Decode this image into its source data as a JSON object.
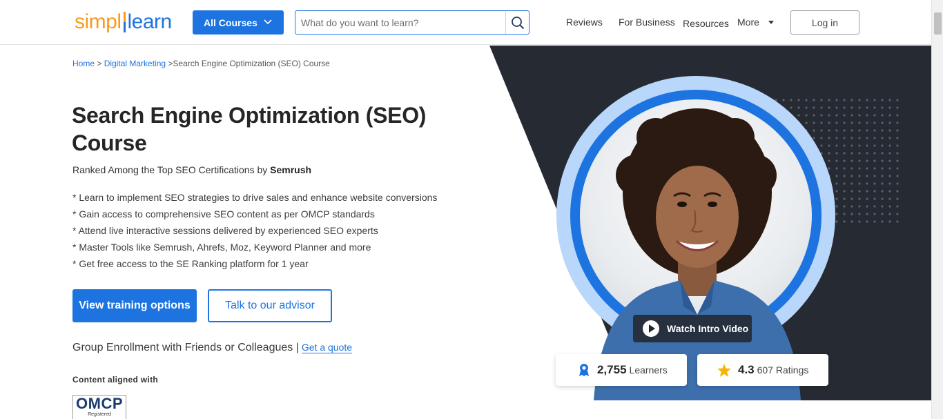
{
  "header": {
    "logo": {
      "left": "simpl",
      "right": "learn"
    },
    "all_courses_label": "All Courses",
    "search_placeholder": "What do you want to learn?",
    "nav": [
      "Reviews",
      "For Business",
      "Resources",
      "More"
    ],
    "login_label": "Log in"
  },
  "hero": {
    "breadcrumb": {
      "home": "Home",
      "sep1": " > ",
      "category": "Digital Marketing",
      "sep2": " >",
      "current": "Search Engine Optimization (SEO) Course"
    },
    "title_line1": "Search Engine Optimization (SEO)",
    "title_line2": "Course",
    "ranked_prefix": "Ranked Among the Top SEO Certifications by ",
    "ranked_brand": "Semrush",
    "bullets": [
      "* Learn to implement SEO strategies to drive sales and enhance website conversions",
      "* Gain access to comprehensive SEO content as per OMCP standards",
      "* Attend live interactive sessions delivered by experienced SEO experts",
      "* Master Tools like Semrush, Ahrefs, Moz, Keyword Planner and more",
      "* Get free access to the SE Ranking platform for 1 year"
    ],
    "primary_cta": "View training options",
    "secondary_cta": "Talk to our advisor",
    "group_text": "Group Enrollment with Friends or Colleagues |",
    "group_link": "Get a quote",
    "aligned_label": "Content aligned with",
    "omcp_logo": "OMCP",
    "omcp_sub": "Registered",
    "watch_video": "Watch Intro Video",
    "learners_count": "2,755",
    "learners_label": "Learners",
    "rating_value": "4.3",
    "rating_label": "607 Ratings"
  },
  "colors": {
    "brand_blue": "#1d74e0",
    "brand_orange": "#f79a1d",
    "hero_dark": "#262a33",
    "star": "#f4b400"
  }
}
